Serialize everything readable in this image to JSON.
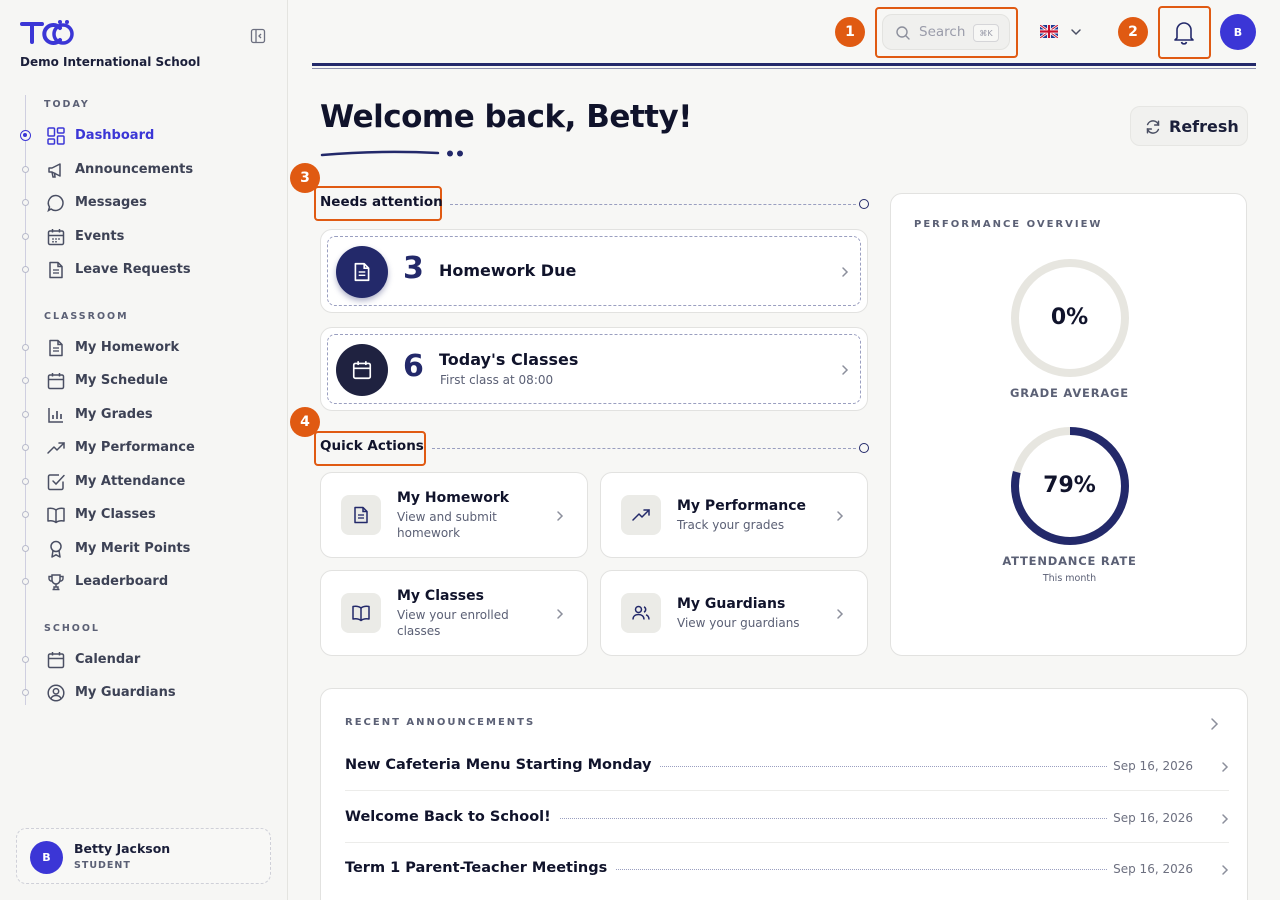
{
  "sidebar": {
    "school_name": "Demo International School",
    "sections": {
      "today": "TODAY",
      "classroom": "CLASSROOM",
      "school": "SCHOOL"
    },
    "items": [
      {
        "label": "Dashboard",
        "icon": "dashboard-icon",
        "active": true
      },
      {
        "label": "Announcements",
        "icon": "megaphone-icon"
      },
      {
        "label": "Messages",
        "icon": "message-icon"
      },
      {
        "label": "Events",
        "icon": "calendar-icon"
      },
      {
        "label": "Leave Requests",
        "icon": "document-icon"
      },
      {
        "label": "My Homework",
        "icon": "document-icon"
      },
      {
        "label": "My Schedule",
        "icon": "calendar-icon"
      },
      {
        "label": "My Grades",
        "icon": "bar-chart-icon"
      },
      {
        "label": "My Performance",
        "icon": "trending-up-icon"
      },
      {
        "label": "My Attendance",
        "icon": "checkbox-icon"
      },
      {
        "label": "My Classes",
        "icon": "book-icon"
      },
      {
        "label": "My Merit Points",
        "icon": "award-icon"
      },
      {
        "label": "Leaderboard",
        "icon": "trophy-icon"
      },
      {
        "label": "Calendar",
        "icon": "calendar-icon"
      },
      {
        "label": "My Guardians",
        "icon": "user-circle-icon"
      }
    ],
    "user": {
      "initial": "B",
      "name": "Betty Jackson",
      "role": "STUDENT"
    }
  },
  "header": {
    "search_placeholder": "Search",
    "search_shortcut": "⌘K",
    "language_flag": "UK",
    "avatar_initial": "B",
    "callouts": [
      "1",
      "2",
      "3",
      "4"
    ]
  },
  "main": {
    "welcome": "Welcome back, Betty!",
    "refresh_label": "Refresh",
    "needs_attention": {
      "heading": "Needs attention",
      "cards": [
        {
          "count": "3",
          "title": "Homework Due",
          "subtitle": ""
        },
        {
          "count": "6",
          "title": "Today's Classes",
          "subtitle": "First class at 08:00"
        }
      ]
    },
    "quick_actions": {
      "heading": "Quick Actions",
      "items": [
        {
          "title": "My Homework",
          "desc": "View and submit homework",
          "icon": "document-icon"
        },
        {
          "title": "My Performance",
          "desc": "Track your grades",
          "icon": "trending-up-icon"
        },
        {
          "title": "My Classes",
          "desc": "View your enrolled classes",
          "icon": "book-icon"
        },
        {
          "title": "My Guardians",
          "desc": "View your guardians",
          "icon": "users-icon"
        }
      ]
    },
    "performance": {
      "title": "PERFORMANCE OVERVIEW",
      "grade_average": {
        "value": "0%",
        "label": "GRADE AVERAGE",
        "fraction": 0
      },
      "attendance": {
        "value": "79%",
        "label": "ATTENDANCE RATE",
        "sub": "This month",
        "fraction": 0.79
      }
    },
    "announcements": {
      "title": "RECENT ANNOUNCEMENTS",
      "items": [
        {
          "title": "New Cafeteria Menu Starting Monday",
          "date": "Sep 16, 2026"
        },
        {
          "title": "Welcome Back to School!",
          "date": "Sep 16, 2026"
        },
        {
          "title": "Term 1 Parent-Teacher Meetings",
          "date": "Sep 16, 2026"
        }
      ]
    }
  },
  "colors": {
    "accent": "#3b36d6",
    "navy": "#23296a",
    "callout": "#e05a12"
  }
}
